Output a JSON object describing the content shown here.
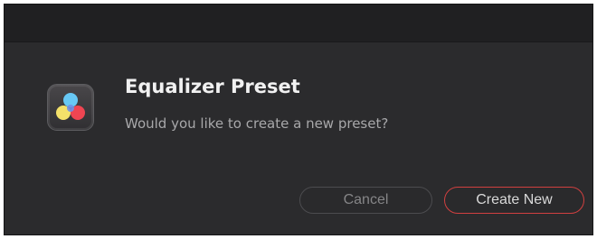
{
  "dialog": {
    "icon": "davinci-resolve-app-icon",
    "title": "Equalizer Preset",
    "message": "Would you like to create a new preset?",
    "buttons": {
      "cancel_label": "Cancel",
      "create_label": "Create New"
    }
  },
  "colors": {
    "dialog_background": "#2b2b2d",
    "title_bar": "#202022",
    "title_text": "#f1f1f1",
    "message_text": "#a8a8aa",
    "primary_button_border": "#d14040"
  }
}
